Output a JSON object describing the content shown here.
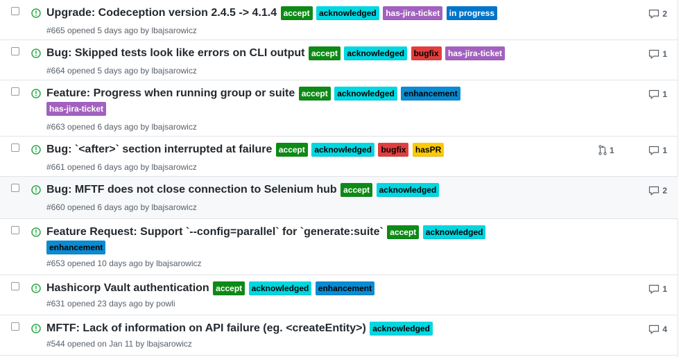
{
  "colors": {
    "open_icon": "#28a745",
    "accept": "#0e8a16",
    "acknowledged": "#00d7e1",
    "has_jira_ticket": "#a261be",
    "in_progress": "#0075ca",
    "bugfix": "#e23e3e",
    "enhancement": "#0a8cd2",
    "hasPR": "#fbca04"
  },
  "issues": [
    {
      "title": "Upgrade: Codeception version 2.4.5 -> 4.1.4",
      "labels": [
        "accept",
        "acknowledged",
        "has-jira-ticket",
        "in progress"
      ],
      "meta_prefix": "#665 opened 5 days ago by ",
      "author": "lbajsarowicz",
      "comments": "2"
    },
    {
      "title": "Bug: Skipped tests look like errors on CLI output",
      "labels": [
        "accept",
        "acknowledged",
        "bugfix",
        "has-jira-ticket"
      ],
      "meta_prefix": "#664 opened 5 days ago by ",
      "author": "lbajsarowicz",
      "comments": "1"
    },
    {
      "title": "Feature: Progress when running group or suite",
      "labels": [
        "accept",
        "acknowledged",
        "enhancement",
        "has-jira-ticket"
      ],
      "meta_prefix": "#663 opened 6 days ago by ",
      "author": "lbajsarowicz",
      "comments": "1"
    },
    {
      "title": "Bug: `<after>` section interrupted at failure",
      "labels": [
        "accept",
        "acknowledged",
        "bugfix",
        "hasPR"
      ],
      "meta_prefix": "#661 opened 6 days ago by ",
      "author": "lbajsarowicz",
      "comments": "1",
      "linked_prs": "1"
    },
    {
      "title": "Bug: MFTF does not close connection to Selenium hub",
      "labels": [
        "accept",
        "acknowledged"
      ],
      "meta_prefix": "#660 opened 6 days ago by ",
      "author": "lbajsarowicz",
      "comments": "2"
    },
    {
      "title": "Feature Request: Support `--config=parallel` for `generate:suite`",
      "labels": [
        "accept",
        "acknowledged",
        "enhancement"
      ],
      "meta_prefix": "#653 opened 10 days ago by ",
      "author": "lbajsarowicz"
    },
    {
      "title": "Hashicorp Vault authentication",
      "labels": [
        "accept",
        "acknowledged",
        "enhancement"
      ],
      "meta_prefix": "#631 opened 23 days ago by ",
      "author": "powli",
      "comments": "1"
    },
    {
      "title": "MFTF: Lack of information on API failure (eg. <createEntity>)",
      "labels": [
        "acknowledged"
      ],
      "meta_prefix": "#544 opened on Jan 11 by ",
      "author": "lbajsarowicz",
      "comments": "4"
    }
  ]
}
